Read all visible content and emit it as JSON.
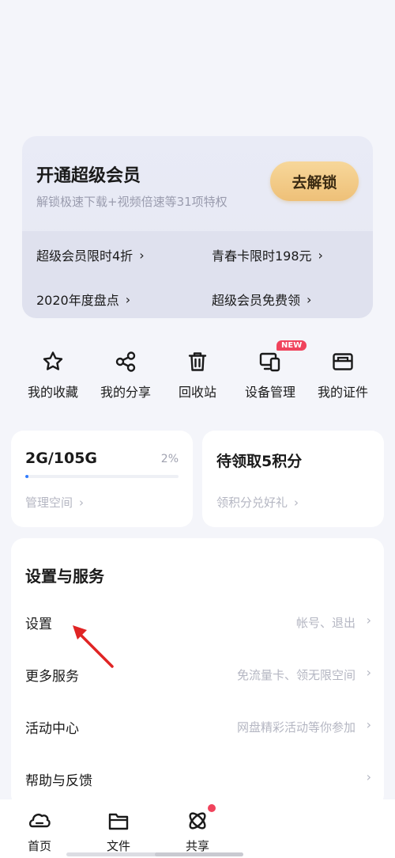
{
  "vip": {
    "title": "开通超级会员",
    "subtitle": "解锁极速下载+视频倍速等31项特权",
    "button": "去解锁",
    "links": [
      {
        "label": "超级会员限时4折"
      },
      {
        "label": "青春卡限时198元"
      },
      {
        "label": "2020年度盘点"
      },
      {
        "label": "超级会员免费领"
      }
    ]
  },
  "quick": {
    "items": [
      {
        "label": "我的收藏",
        "icon": "star-icon"
      },
      {
        "label": "我的分享",
        "icon": "share-icon"
      },
      {
        "label": "回收站",
        "icon": "trash-icon"
      },
      {
        "label": "设备管理",
        "icon": "devices-icon",
        "badge": "NEW"
      },
      {
        "label": "我的证件",
        "icon": "id-card-icon"
      }
    ]
  },
  "storage": {
    "value": "2G/105G",
    "percent": "2%",
    "progress_fraction": 0.02,
    "link": "管理空间"
  },
  "points": {
    "value": "待领取5积分",
    "link": "领积分兑好礼"
  },
  "settings": {
    "title": "设置与服务",
    "rows": [
      {
        "label": "设置",
        "hint": "帐号、退出"
      },
      {
        "label": "更多服务",
        "hint": "免流量卡、领无限空间"
      },
      {
        "label": "活动中心",
        "hint": "网盘精彩活动等你参加"
      },
      {
        "label": "帮助与反馈",
        "hint": ""
      }
    ]
  },
  "nav": {
    "items": [
      {
        "label": "首页",
        "icon": "home-icon"
      },
      {
        "label": "文件",
        "icon": "folder-icon"
      },
      {
        "label": "共享",
        "icon": "share-atom-icon"
      }
    ]
  },
  "colors": {
    "accent": "#2f7bff",
    "badge": "#f0435c",
    "vip_button": "#eec078",
    "annotation_arrow": "#e02424"
  }
}
